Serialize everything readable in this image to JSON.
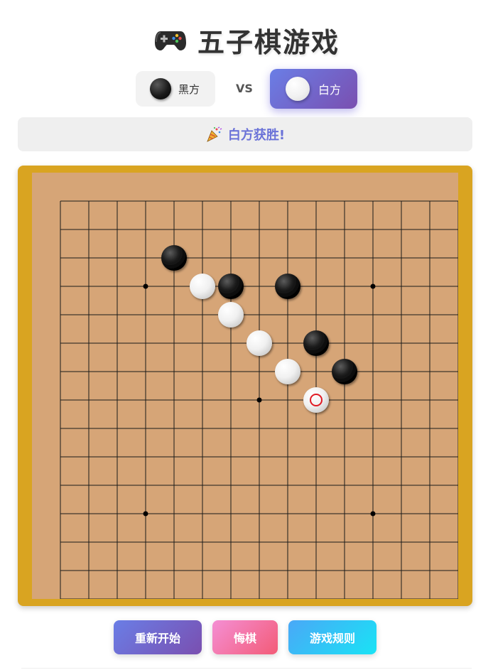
{
  "header": {
    "title": "五子棋游戏",
    "icon": "gamepad-icon"
  },
  "players": {
    "black_label": "黑方",
    "white_label": "白方",
    "vs": "VS",
    "active": "white"
  },
  "status": {
    "icon": "party-popper-icon",
    "text": "白方获胜!"
  },
  "board": {
    "size": 15,
    "star_points": [
      [
        3,
        3
      ],
      [
        11,
        3
      ],
      [
        7,
        7
      ],
      [
        3,
        11
      ],
      [
        11,
        11
      ]
    ],
    "stones": [
      {
        "color": "black",
        "col": 4,
        "row": 2
      },
      {
        "color": "white",
        "col": 5,
        "row": 3
      },
      {
        "color": "black",
        "col": 6,
        "row": 3
      },
      {
        "color": "black",
        "col": 8,
        "row": 3
      },
      {
        "color": "white",
        "col": 6,
        "row": 4
      },
      {
        "color": "white",
        "col": 7,
        "row": 5
      },
      {
        "color": "black",
        "col": 9,
        "row": 5
      },
      {
        "color": "white",
        "col": 8,
        "row": 6
      },
      {
        "color": "black",
        "col": 10,
        "row": 6
      },
      {
        "color": "white",
        "col": 9,
        "row": 7,
        "last_move": true
      }
    ],
    "colors": {
      "frame": "#d9a421",
      "surface": "#d6a577",
      "last_move_marker": "#e01b24"
    }
  },
  "buttons": {
    "restart": "重新开始",
    "undo": "悔棋",
    "rules": "游戏规则"
  }
}
